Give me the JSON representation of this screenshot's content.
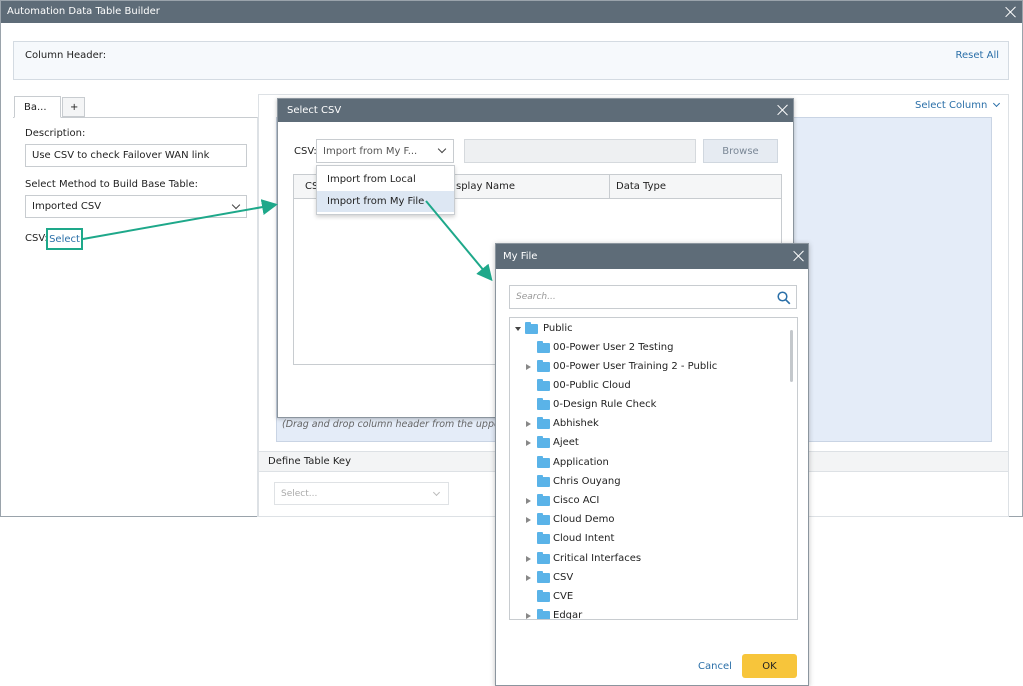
{
  "main_window": {
    "title": "Automation Data Table Builder",
    "column_header_label": "Column Header:",
    "reset_all": "Reset All",
    "tabs": [
      {
        "label": "Ba..."
      },
      {
        "label": "+"
      }
    ],
    "description_label": "Description:",
    "description_value": "Use CSV to check Failover WAN link",
    "method_label": "Select Method to Build Base Table:",
    "method_value": "Imported CSV",
    "csv_label": "CSV:",
    "csv_select": "Select",
    "select_column": "Select Column",
    "drag_hint": "(Drag and drop column header from the upper are",
    "define_table_key": "Define Table Key",
    "key_placeholder": "Select..."
  },
  "select_csv_dialog": {
    "title": "Select CSV",
    "csv_label": "CSV:",
    "source_value": "Import from My F...",
    "browse": "Browse",
    "columns": [
      "CS",
      "splay Name",
      "Data Type"
    ],
    "dropdown_options": [
      "Import from Local",
      "Import from My File"
    ]
  },
  "my_file_dialog": {
    "title": "My File",
    "search_placeholder": "Search...",
    "root": "Public",
    "items": [
      {
        "label": "00-Power User 2 Testing",
        "expandable": false
      },
      {
        "label": "00-Power User Training 2 - Public",
        "expandable": true
      },
      {
        "label": "00-Public Cloud",
        "expandable": false
      },
      {
        "label": "0-Design Rule Check",
        "expandable": false
      },
      {
        "label": "Abhishek",
        "expandable": true
      },
      {
        "label": "Ajeet",
        "expandable": true
      },
      {
        "label": "Application",
        "expandable": false
      },
      {
        "label": "Chris Ouyang",
        "expandable": false
      },
      {
        "label": "Cisco ACI",
        "expandable": true
      },
      {
        "label": "Cloud Demo",
        "expandable": true
      },
      {
        "label": "Cloud Intent",
        "expandable": false
      },
      {
        "label": "Critical Interfaces",
        "expandable": true
      },
      {
        "label": "CSV",
        "expandable": true
      },
      {
        "label": "CVE",
        "expandable": false
      },
      {
        "label": "Edgar",
        "expandable": true
      }
    ],
    "cancel": "Cancel",
    "ok": "OK"
  },
  "colors": {
    "titlebar": "#5e6c78",
    "accent_teal": "#1ea88a",
    "ok_button": "#f7c53b",
    "link": "#2a6fa8",
    "folder": "#5ab3e8"
  }
}
